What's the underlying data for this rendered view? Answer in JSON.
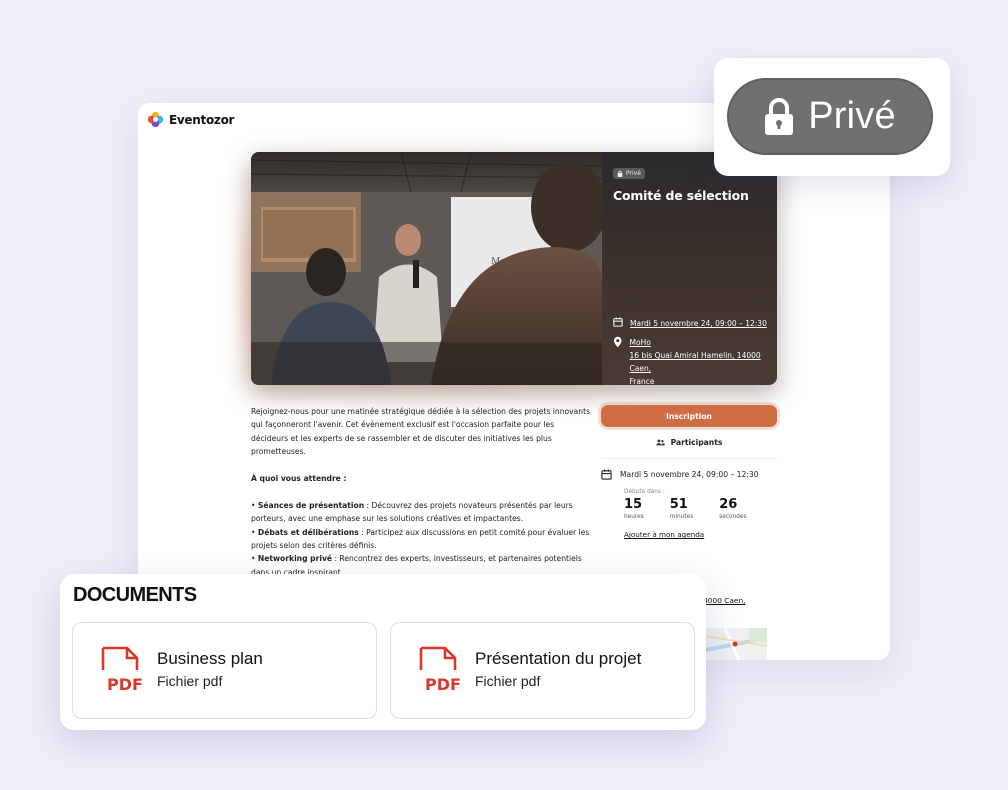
{
  "brand": {
    "name": "Eventozor"
  },
  "colors": {
    "background": "#efeef9",
    "accent": "#cf6d45",
    "pdf_red": "#d9372b",
    "pill_gray": "#707070"
  },
  "private_badge": {
    "label": "Privé",
    "icon": "lock-icon"
  },
  "event": {
    "badge": "Privé",
    "title": "Comité de sélection",
    "date": "Mardi 5 novembre 24, 09:00 – 12:30",
    "venue": "MoHo",
    "address_line1": "16 bis Quai Amiral Hamelin, 14000 Caen,",
    "address_line2": "France"
  },
  "description": {
    "intro": "Rejoignez-nous pour une matinée stratégique dédiée à la sélection des projets innovants qui façonneront l'avenir. Cet évènement exclusif est l'occasion parfaite pour les décideurs et les experts de se rassembler et de discuter des initiatives les plus prometteuses.",
    "heading": "À quoi vous attendre :",
    "items": [
      {
        "bold": "Séances de présentation",
        "text": " : Découvrez des projets novateurs présentés par leurs porteurs, avec une emphase sur les solutions créatives et impactantes."
      },
      {
        "bold": "Débats et délibérations",
        "text": " : Participez aux discussions en petit comité pour évaluer les projets selon des critères définis."
      },
      {
        "bold": "Networking privé",
        "text": " : Rencontrez des experts, investisseurs, et partenaires potentiels dans un cadre inspirant."
      }
    ]
  },
  "sidebar": {
    "register_label": "Inscription",
    "participants_label": "Participants",
    "date": "Mardi 5 novembre 24, 09:00 – 12:30",
    "starts_in_label": "Débute dans :",
    "countdown": [
      {
        "value": "15",
        "unit": "heures"
      },
      {
        "value": "51",
        "unit": "minutes"
      },
      {
        "value": "26",
        "unit": "secondes"
      }
    ],
    "add_agenda": "Ajouter à mon agenda",
    "address_fragment": "n, 14000 Caen,"
  },
  "documents": {
    "title": "DOCUMENTS",
    "files": [
      {
        "name": "Business plan",
        "type": "Fichier pdf",
        "icon": "pdf-file-icon"
      },
      {
        "name": "Présentation du projet",
        "type": "Fichier pdf",
        "icon": "pdf-file-icon"
      }
    ]
  }
}
